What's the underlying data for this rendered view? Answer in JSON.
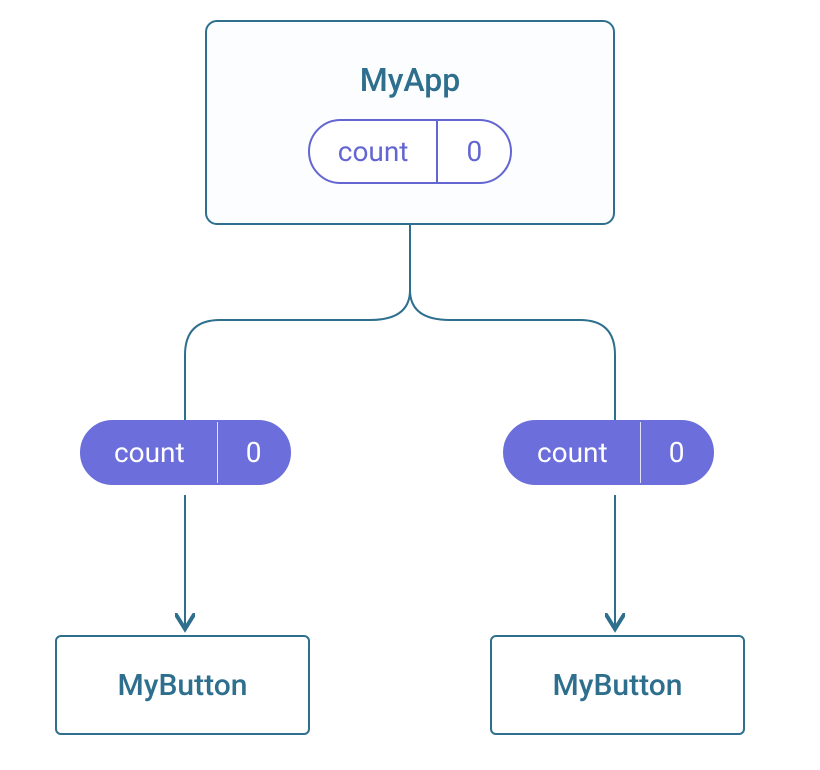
{
  "parent": {
    "title": "MyApp",
    "state": {
      "label": "count",
      "value": "0"
    }
  },
  "props": {
    "left": {
      "label": "count",
      "value": "0"
    },
    "right": {
      "label": "count",
      "value": "0"
    }
  },
  "children": {
    "left": "MyButton",
    "right": "MyButton"
  },
  "colors": {
    "border": "#2e6f8e",
    "accent": "#6b6edb"
  }
}
